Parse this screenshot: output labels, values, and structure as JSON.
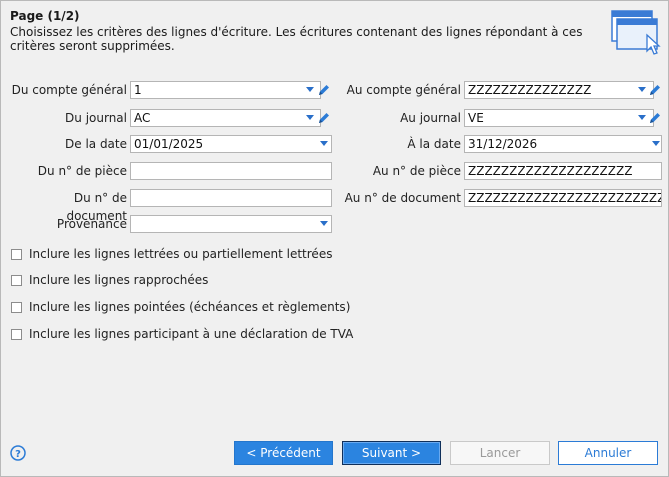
{
  "page": {
    "title": "Page (1/2)",
    "description": "Choisissez les critères des lignes d'écriture. Les écritures contenant des lignes répondant à ces critères seront supprimées."
  },
  "form": {
    "left": {
      "compte_general": {
        "label": "Du compte général",
        "value": "1"
      },
      "journal": {
        "label": "Du journal",
        "value": "AC"
      },
      "date": {
        "label": "De la date",
        "value": "01/01/2025"
      },
      "piece": {
        "label": "Du n° de pièce",
        "value": ""
      },
      "document": {
        "label": "Du n° de document",
        "value": ""
      },
      "provenance": {
        "label": "Provenance",
        "value": ""
      }
    },
    "right": {
      "compte_general": {
        "label": "Au compte général",
        "value": "ZZZZZZZZZZZZZZZ"
      },
      "journal": {
        "label": "Au journal",
        "value": "VE"
      },
      "date": {
        "label": "À la date",
        "value": "31/12/2026"
      },
      "piece": {
        "label": "Au n° de pièce",
        "value": "ZZZZZZZZZZZZZZZZZZZZ"
      },
      "document": {
        "label": "Au n° de document",
        "value": "ZZZZZZZZZZZZZZZZZZZZZZZZZZZZZZZZZZZ"
      }
    }
  },
  "options": [
    {
      "label": "Inclure les lignes lettrées ou partiellement lettrées",
      "checked": false
    },
    {
      "label": "Inclure les lignes rapprochées",
      "checked": false
    },
    {
      "label": "Inclure les lignes pointées (échéances et règlements)",
      "checked": false
    },
    {
      "label": "Inclure les lignes participant à une déclaration de TVA",
      "checked": false
    }
  ],
  "buttons": {
    "previous": "< Précédent",
    "next": "Suivant >",
    "cancel_run": "Lancer",
    "cancel": "Annuler"
  },
  "icons": {
    "help": "help-icon",
    "pencil": "pencil-icon",
    "dropdown": "chevron-down-icon",
    "wizard": "window-cursor-icon"
  },
  "colors": {
    "accent": "#2b84e0",
    "background": "#f0f0f0"
  }
}
